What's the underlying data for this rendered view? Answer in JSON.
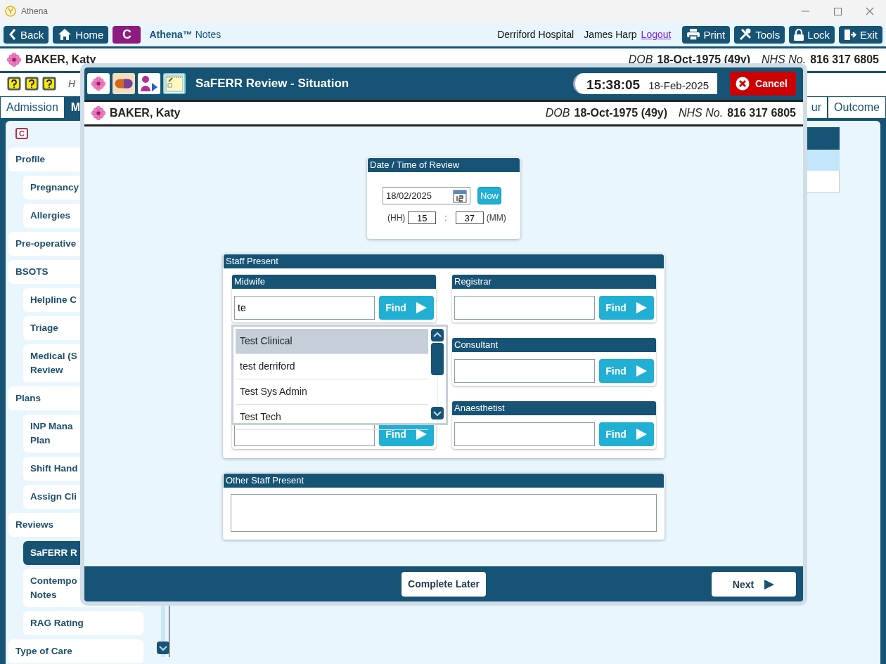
{
  "window": {
    "title": "Athena"
  },
  "toolbar": {
    "back": "Back",
    "home": "Home",
    "c_button": "C",
    "app_name": "**Athena™** Notes",
    "location": "Derriford Hospital",
    "user": "James Harp",
    "logout": "Logout",
    "buttons": [
      {
        "kind": "print",
        "label": "Print"
      },
      {
        "kind": "tools",
        "label": "Tools"
      },
      {
        "kind": "lock",
        "label": "Lock"
      },
      {
        "kind": "exit",
        "label": "Exit"
      }
    ]
  },
  "patient": {
    "name": "BAKER, Katy",
    "dob_label": "DOB",
    "dob": "18-Oct-1975 (49y)",
    "nhs_label": "NHS No.",
    "nhs": "816 317 6805"
  },
  "info_row": {
    "text": "H"
  },
  "tabs": [
    {
      "label": "Admission",
      "selected": false
    },
    {
      "label": "M",
      "selected": true
    },
    {
      "label": "ur",
      "selected": false
    },
    {
      "label": "Outcome",
      "selected": false
    }
  ],
  "sidebar": {
    "badge": "C",
    "items": [
      {
        "label": "Profile",
        "selected": false,
        "children": [
          {
            "label": "Pregnancy",
            "selected": false
          },
          {
            "label": "Allergies",
            "selected": false
          }
        ]
      },
      {
        "label": "Pre-operative",
        "selected": false
      },
      {
        "label": "BSOTS",
        "selected": false,
        "children": [
          {
            "label": "Helpline C",
            "selected": false
          },
          {
            "label": "Triage",
            "selected": false
          },
          {
            "label": "Medical (S\nReview",
            "selected": false
          }
        ]
      },
      {
        "label": "Plans",
        "selected": false,
        "children": [
          {
            "label": "INP Mana\nPlan",
            "selected": false
          },
          {
            "label": "Shift Hand",
            "selected": false
          },
          {
            "label": "Assign Cli",
            "selected": false
          }
        ]
      },
      {
        "label": "Reviews",
        "selected": false,
        "children": [
          {
            "label": "SaFERR R",
            "selected": true
          },
          {
            "label": "Contempo\nNotes",
            "selected": false
          },
          {
            "label": "RAG Rating",
            "selected": false
          }
        ]
      },
      {
        "label": "Type of Care",
        "selected": false
      }
    ]
  },
  "modal": {
    "title": "SaFERR Review - Situation",
    "time": "15:38:05",
    "date": "18-Feb-2025",
    "cancel": "Cancel",
    "patient": {
      "name": "BAKER, Katy",
      "dob_label": "DOB",
      "dob": "18-Oct-1975 (49y)",
      "nhs_label": "NHS No.",
      "nhs": "816 317 6805"
    },
    "review_time": {
      "title": "Date / Time of Review",
      "date": "18/02/2025",
      "now": "Now",
      "hh_label": "(HH)",
      "hh": "15",
      "separator": ":",
      "mm": "37",
      "mm_label": "(MM)"
    },
    "staff": {
      "title": "Staff Present",
      "left": [
        {
          "label": "Midwife",
          "value": "te",
          "find": "Find"
        },
        {
          "find": "Find"
        }
      ],
      "right": [
        {
          "label": "Registrar",
          "find": "Find"
        },
        {
          "label": "Consultant",
          "find": "Find"
        },
        {
          "label": "Anaesthetist",
          "find": "Find"
        }
      ],
      "dropdown": [
        {
          "label": "Test Clinical",
          "selected": true
        },
        {
          "label": "test derriford",
          "selected": false
        },
        {
          "label": "Test Sys Admin",
          "selected": false
        },
        {
          "label": "Test Tech",
          "selected": false
        }
      ]
    },
    "other_staff": {
      "title": "Other Staff Present"
    },
    "footer": {
      "complete_later": "Complete Later",
      "next": "Next"
    }
  }
}
